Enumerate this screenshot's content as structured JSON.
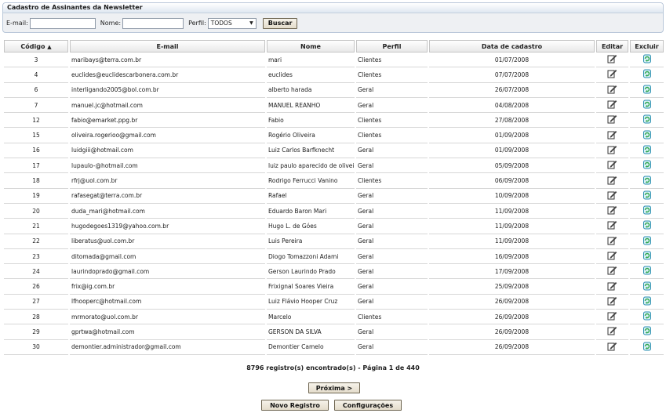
{
  "panel": {
    "title": "Cadastro de Assinantes da Newsletter",
    "email_label": "E-mail:",
    "email_value": "",
    "name_label": "Nome:",
    "name_value": "",
    "profile_label": "Perfil:",
    "profile_selected": "TODOS",
    "search_button": "Buscar"
  },
  "table": {
    "headers": {
      "code": "Código",
      "email": "E-mail",
      "name": "Nome",
      "profile": "Perfil",
      "date": "Data de cadastro",
      "edit": "Editar",
      "delete": "Excluir"
    },
    "rows": [
      {
        "code": "3",
        "email": "maribays@terra.com.br",
        "name": "mari",
        "profile": "Clientes",
        "date": "01/07/2008"
      },
      {
        "code": "4",
        "email": "euclides@euclidescarbonera.com.br",
        "name": "euclides",
        "profile": "Clientes",
        "date": "07/07/2008"
      },
      {
        "code": "6",
        "email": "interligando2005@bol.com.br",
        "name": "alberto harada",
        "profile": "Geral",
        "date": "26/07/2008"
      },
      {
        "code": "7",
        "email": "manuel.jc@hotmail.com",
        "name": "MANUEL REANHO",
        "profile": "Geral",
        "date": "04/08/2008"
      },
      {
        "code": "12",
        "email": "fabio@emarket.ppg.br",
        "name": "Fabio",
        "profile": "Clientes",
        "date": "27/08/2008"
      },
      {
        "code": "15",
        "email": "oliveira.rogerioo@gmail.com",
        "name": "Rogério Oliveira",
        "profile": "Clientes",
        "date": "01/09/2008"
      },
      {
        "code": "16",
        "email": "luidgiii@hotmail.com",
        "name": "Luiz Carlos Barfknecht",
        "profile": "Geral",
        "date": "01/09/2008"
      },
      {
        "code": "17",
        "email": "lupaulo-@hotmail.com",
        "name": "luiz paulo aparecido de oliveira",
        "profile": "Geral",
        "date": "05/09/2008"
      },
      {
        "code": "18",
        "email": "rfrj@uol.com.br",
        "name": "Rodrigo Ferrucci Vanino",
        "profile": "Clientes",
        "date": "06/09/2008"
      },
      {
        "code": "19",
        "email": "rafasegat@terra.com.br",
        "name": "Rafael",
        "profile": "Geral",
        "date": "10/09/2008"
      },
      {
        "code": "20",
        "email": "duda_mari@hotmail.com",
        "name": "Eduardo Baron Mari",
        "profile": "Geral",
        "date": "11/09/2008"
      },
      {
        "code": "21",
        "email": "hugodegoes1319@yahoo.com.br",
        "name": "Hugo L. de Góes",
        "profile": "Geral",
        "date": "11/09/2008"
      },
      {
        "code": "22",
        "email": "liberatus@uol.com.br",
        "name": "Luis Pereira",
        "profile": "Geral",
        "date": "11/09/2008"
      },
      {
        "code": "23",
        "email": "ditomada@gmail.com",
        "name": "Diogo Tomazzoni Adami",
        "profile": "Geral",
        "date": "16/09/2008"
      },
      {
        "code": "24",
        "email": "laurindoprado@gmail.com",
        "name": "Gerson Laurindo Prado",
        "profile": "Geral",
        "date": "17/09/2008"
      },
      {
        "code": "26",
        "email": "frix@ig.com.br",
        "name": "Frixignal Soares Vieira",
        "profile": "Geral",
        "date": "25/09/2008"
      },
      {
        "code": "27",
        "email": "lfhooperc@hotmail.com",
        "name": "Luiz Flávio Hooper Cruz",
        "profile": "Geral",
        "date": "26/09/2008"
      },
      {
        "code": "28",
        "email": "mrmorato@uol.com.br",
        "name": "Marcelo",
        "profile": "Clientes",
        "date": "26/09/2008"
      },
      {
        "code": "29",
        "email": "gprtwa@hotmail.com",
        "name": "GERSON DA SILVA",
        "profile": "Geral",
        "date": "26/09/2008"
      },
      {
        "code": "30",
        "email": "demontier.administrador@gmail.com",
        "name": "Demontier Camelo",
        "profile": "Geral",
        "date": "26/09/2008"
      }
    ]
  },
  "footer": {
    "count_text": "8796 registro(s) encontrado(s) - Página 1 de 440",
    "next_button": "Próxima >",
    "new_button": "Novo Registro",
    "config_button": "Configurações"
  }
}
